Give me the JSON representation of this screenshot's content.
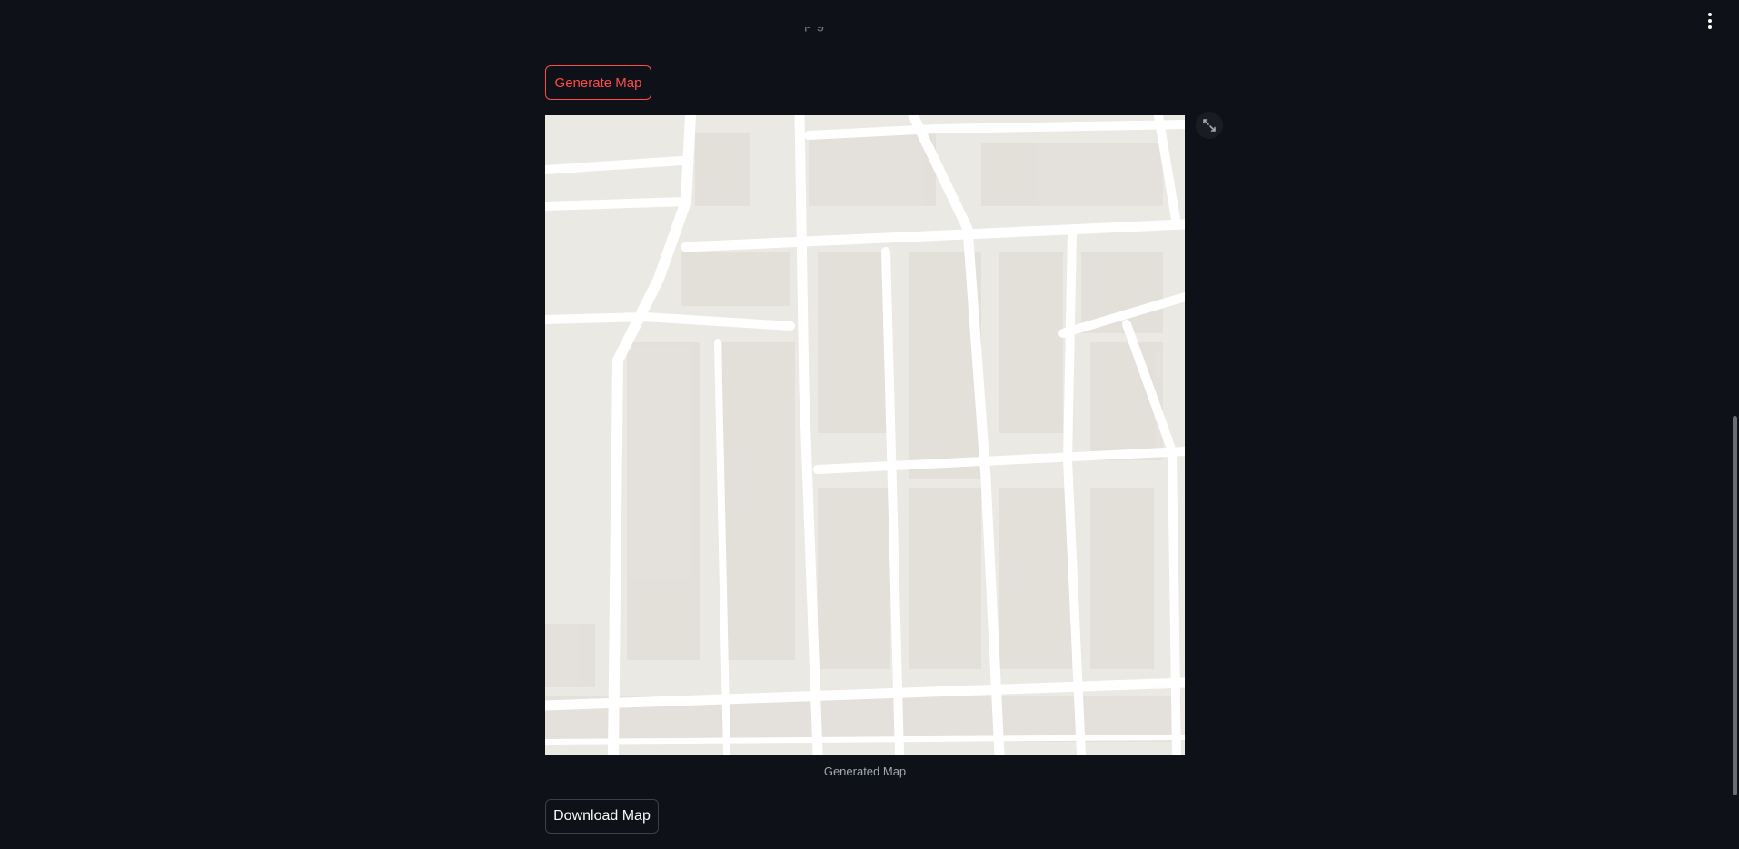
{
  "page": {
    "partial_text": "p                 g"
  },
  "header": {
    "menu_icon": "vertical-ellipsis-icon"
  },
  "actions": {
    "generate_label": "Generate Map",
    "download_label": "Download Map"
  },
  "map": {
    "caption": "Generated Map",
    "expand_icon": "expand-arrows-icon"
  },
  "colors": {
    "background": "#0e1117",
    "accent": "#ff4b4b",
    "map_land": "#ebe9e4",
    "map_road": "#ffffff",
    "caption_text": "#a3a8b4"
  }
}
